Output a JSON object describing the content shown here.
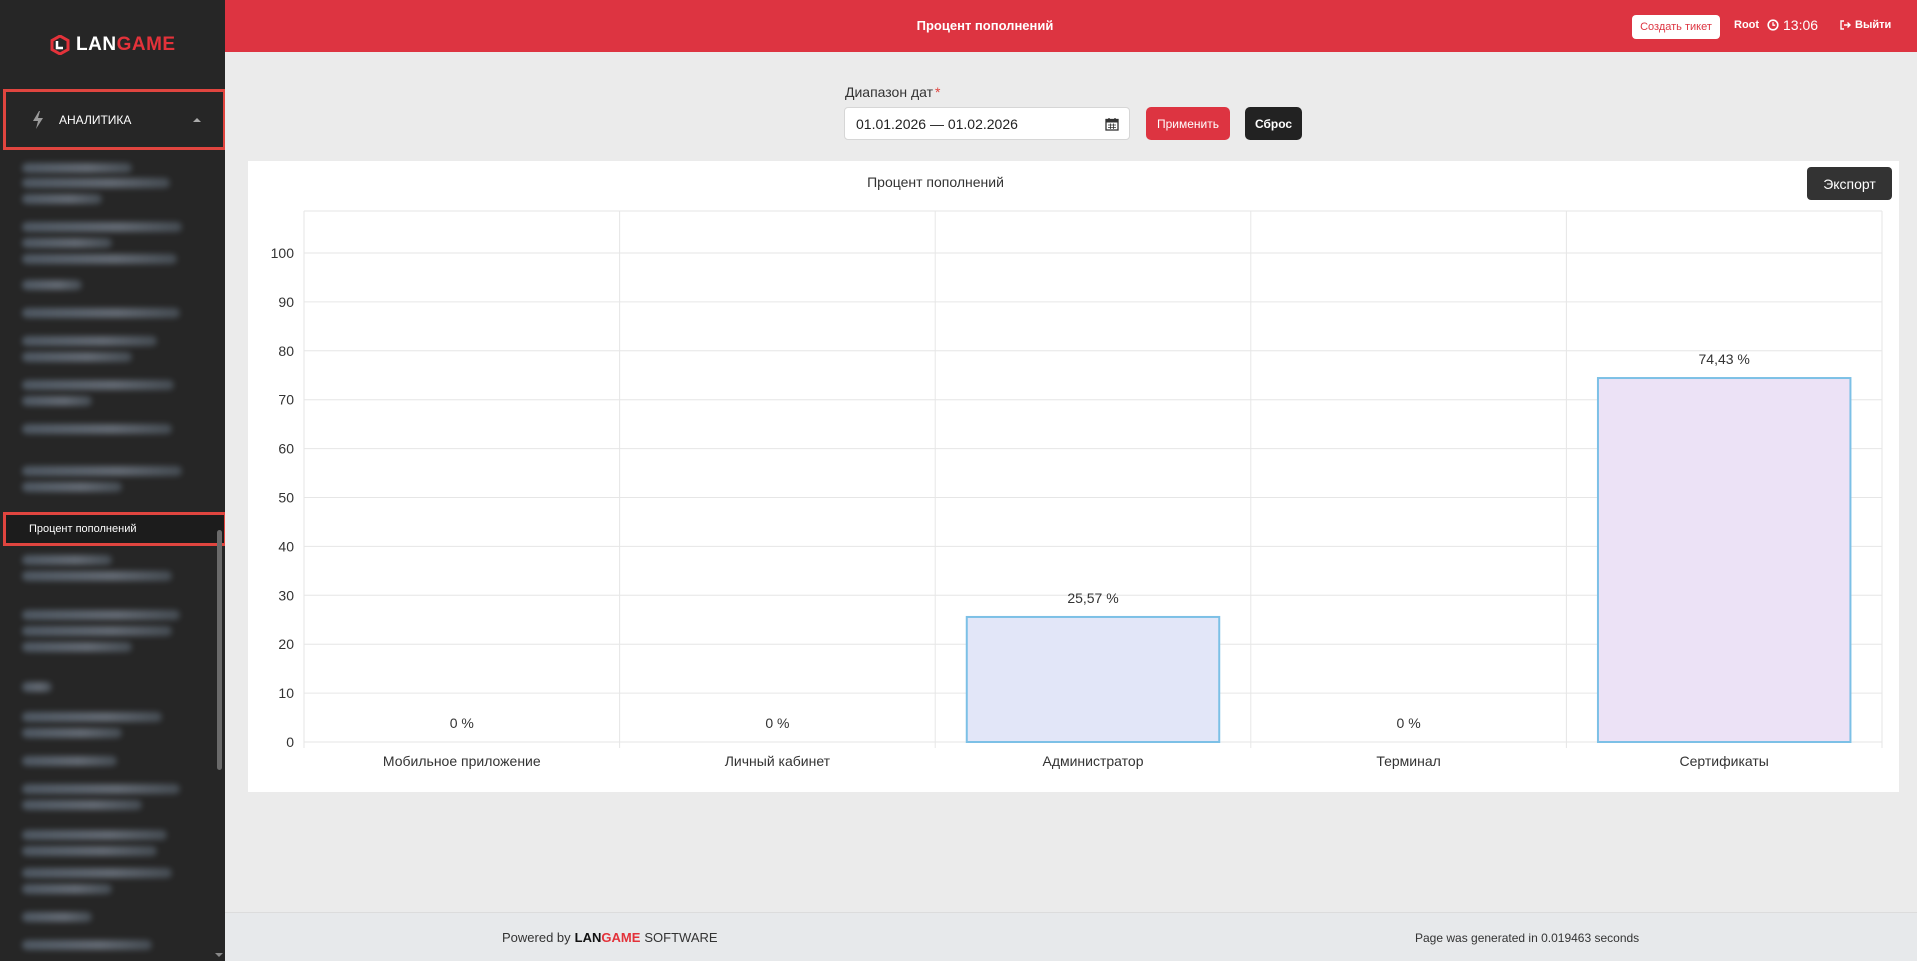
{
  "app": {
    "logo_lan": "LAN",
    "logo_game": "GAME",
    "brand_color": "#dd3441"
  },
  "sidebar": {
    "section_label": "АНАЛИТИКА",
    "section_icon": "bolt-icon",
    "active_item": "Процент пополнений"
  },
  "header": {
    "title": "Процент пополнений",
    "ticket_label": "Создать тикет",
    "user": "Root",
    "time": "13:06",
    "logout_label": "Выйти"
  },
  "filter": {
    "label": "Диапазон дат",
    "required_mark": "*",
    "value": "01.01.2026 — 01.02.2026",
    "apply_label": "Применить",
    "reset_label": "Сброс"
  },
  "export_label": "Экспорт",
  "chart_data": {
    "type": "bar",
    "title": "Процент пополнений",
    "categories": [
      "Мобильное приложение",
      "Личный кабинет",
      "Администратор",
      "Терминал",
      "Сертификаты"
    ],
    "values": [
      0,
      0,
      25.57,
      0,
      74.43
    ],
    "data_labels": [
      "0 %",
      "0 %",
      "25,57 %",
      "0 %",
      "74,43 %"
    ],
    "y_ticks": [
      "0",
      "10",
      "20",
      "30",
      "40",
      "50",
      "60",
      "70",
      "80",
      "90",
      "100"
    ],
    "ylim": [
      0,
      100
    ],
    "grid": true,
    "bar_fill_colors": [
      "#e2e6f8",
      "#e2e6f8",
      "#e2e6f8",
      "#e2e6f8",
      "#ece2f6"
    ],
    "bar_border_color": "#7cc0e6"
  },
  "footer": {
    "powered_by": "Powered by",
    "brand_lan": "LAN",
    "brand_game": "GAME",
    "software": "SOFTWARE",
    "generated": "Page was generated in 0.019463 seconds"
  }
}
